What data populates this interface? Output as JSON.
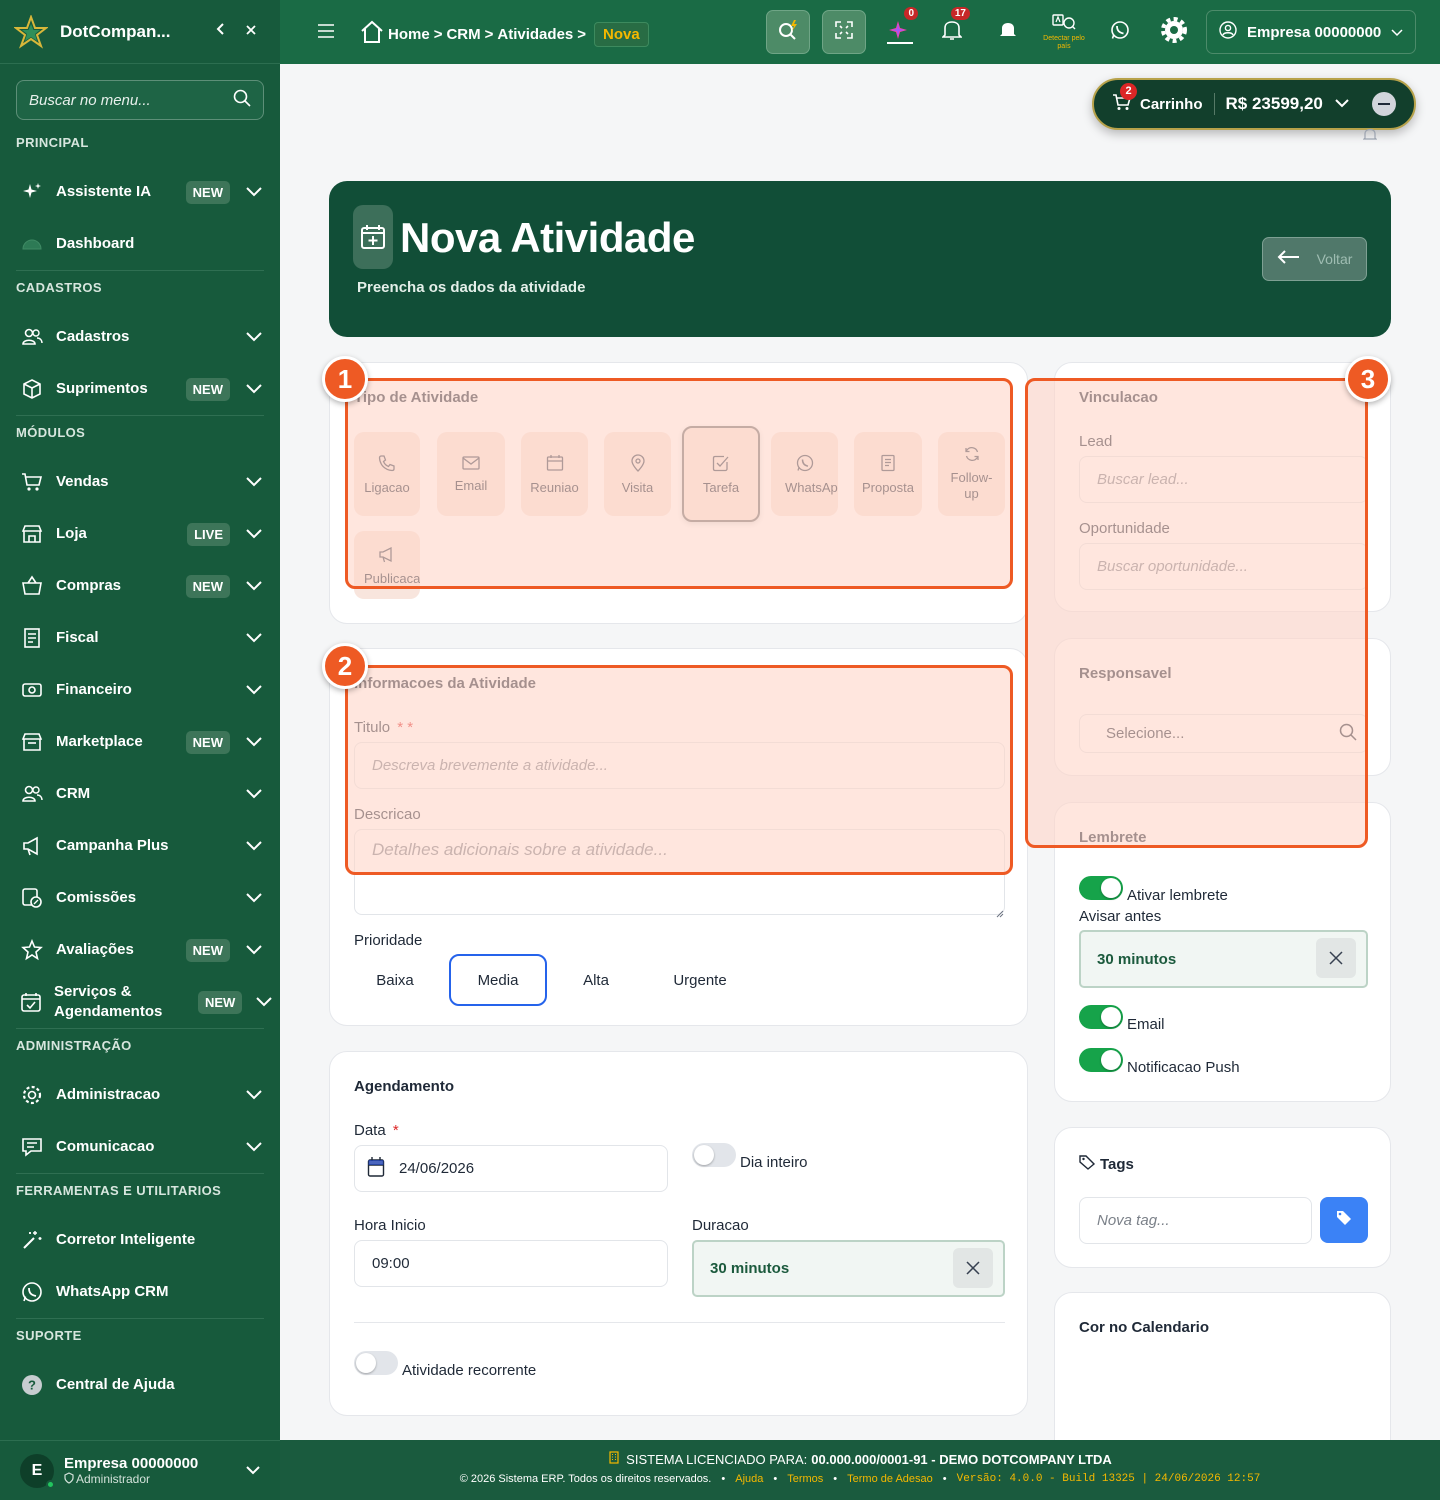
{
  "sidebar": {
    "brand": "DotCompan...",
    "search_placeholder": "Buscar no menu...",
    "sections": {
      "principal": "PRINCIPAL",
      "cadastros": "CADASTROS",
      "modulos": "MÓDULOS",
      "administracao": "ADMINISTRAÇÃO",
      "ferramentas": "FERRAMENTAS E UTILITARIOS",
      "suporte": "SUPORTE"
    },
    "items": {
      "assistente": {
        "label": "Assistente IA",
        "badge": "NEW"
      },
      "dashboard": {
        "label": "Dashboard"
      },
      "cadastros": {
        "label": "Cadastros"
      },
      "suprimentos": {
        "label": "Suprimentos",
        "badge": "NEW"
      },
      "vendas": {
        "label": "Vendas"
      },
      "loja": {
        "label": "Loja",
        "badge": "LIVE"
      },
      "compras": {
        "label": "Compras",
        "badge": "NEW"
      },
      "fiscal": {
        "label": "Fiscal"
      },
      "financeiro": {
        "label": "Financeiro"
      },
      "marketplace": {
        "label": "Marketplace",
        "badge": "NEW"
      },
      "crm": {
        "label": "CRM"
      },
      "campanha": {
        "label": "Campanha Plus"
      },
      "comissoes": {
        "label": "Comissões"
      },
      "avaliacoes": {
        "label": "Avaliações",
        "badge": "NEW"
      },
      "servicos": {
        "label": "Serviços & Agendamentos",
        "badge": "NEW"
      },
      "administracao": {
        "label": "Administracao"
      },
      "comunicacao": {
        "label": "Comunicacao"
      },
      "corretor": {
        "label": "Corretor Inteligente"
      },
      "whatsapp": {
        "label": "WhatsApp CRM"
      },
      "ajuda": {
        "label": "Central de Ajuda"
      }
    },
    "user": {
      "initial": "E",
      "name": "Empresa 00000000",
      "role": "Administrador"
    }
  },
  "topbar": {
    "breadcrumb": [
      "Home",
      "CRM",
      "Atividades"
    ],
    "current": "Nova",
    "ai_badge": "0",
    "notif_badge": "17",
    "detect_label": "Detectar pelo país",
    "company": "Empresa 00000000"
  },
  "cart": {
    "badge": "2",
    "label": "Carrinho",
    "total": "R$ 23599,20"
  },
  "hero": {
    "title": "Nova Atividade",
    "subtitle": "Preencha os dados da atividade",
    "back": "Voltar"
  },
  "tipo": {
    "title": "Tipo de Atividade",
    "types": [
      "Ligacao",
      "Email",
      "Reuniao",
      "Visita",
      "Tarefa",
      "WhatsApp",
      "Proposta",
      "Follow-up",
      "Publicacao"
    ],
    "selected": "Tarefa"
  },
  "info": {
    "title": "Informacoes da Atividade",
    "titulo_label": "Titulo",
    "required_mark": "* *",
    "titulo_placeholder": "Descreva brevemente a atividade...",
    "descricao_label": "Descricao",
    "descricao_placeholder": "Detalhes adicionais sobre a atividade...",
    "prioridade_label": "Prioridade",
    "prioridades": [
      "Baixa",
      "Media",
      "Alta",
      "Urgente"
    ],
    "prioridade_selected": "Media"
  },
  "agendamento": {
    "title": "Agendamento",
    "data_label": "Data",
    "data_required": "*",
    "data_value": "24/06/2026",
    "dia_inteiro": "Dia inteiro",
    "hora_label": "Hora Inicio",
    "hora_value": "09:00",
    "duracao_label": "Duracao",
    "duracao_value": "30 minutos",
    "recorrente": "Atividade recorrente"
  },
  "vinculacao": {
    "title": "Vinculacao",
    "lead_label": "Lead",
    "lead_placeholder": "Buscar lead...",
    "op_label": "Oportunidade",
    "op_placeholder": "Buscar oportunidade..."
  },
  "responsavel": {
    "title": "Responsavel",
    "placeholder": "Selecione..."
  },
  "lembrete": {
    "title": "Lembrete",
    "ativar": "Ativar lembrete",
    "avisar_label": "Avisar antes",
    "avisar_value": "30 minutos",
    "email": "Email",
    "push": "Notificacao Push"
  },
  "tags": {
    "title": "Tags",
    "placeholder": "Nova tag..."
  },
  "cor": {
    "title": "Cor no Calendario"
  },
  "markers": [
    "1",
    "2",
    "3"
  ],
  "footer": {
    "license_prefix": "SISTEMA LICENCIADO PARA:",
    "license_value": "00.000.000/0001-91 - DEMO DOTCOMPANY LTDA",
    "copyright": "© 2026 Sistema ERP. Todos os direitos reservados.",
    "links": [
      "Ajuda",
      "Termos",
      "Termo de Adesao"
    ],
    "version": "Versão: 4.0.0 - Build 13325 | 24/06/2026 12:57"
  },
  "colors": {
    "sidebar": "#175a3c",
    "topbar": "#1a6b45",
    "hero": "#114e37",
    "annotation": "#ee5a24",
    "toggle_on": "#16a34a",
    "tag_button": "#3b82f6"
  }
}
